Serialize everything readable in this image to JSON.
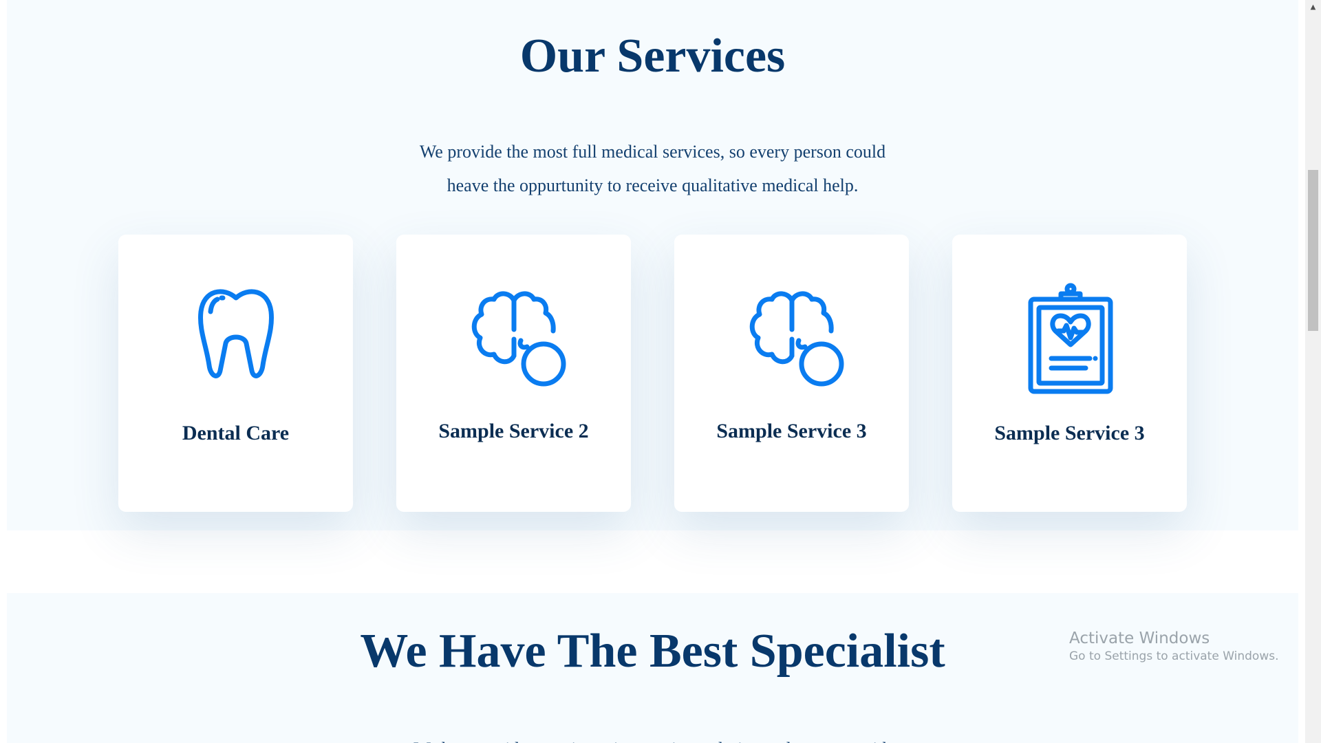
{
  "services": {
    "title": "Our Services",
    "description_lines": [
      "We provide the most full medical services, so every person could",
      "heave the oppurtunity to receive qualitative medical help."
    ],
    "cards": [
      {
        "title": "Dental Care",
        "icon": "tooth-icon"
      },
      {
        "title": "Sample Service 2",
        "icon": "brain-icon"
      },
      {
        "title": "Sample Service 3",
        "icon": "brain-icon"
      },
      {
        "title": "Sample Service 3",
        "icon": "clipboard-heart-icon"
      }
    ]
  },
  "specialist": {
    "title": "We Have The Best Specialist",
    "description": "We have a wide experience in experience design and strategy, with"
  },
  "watermark": {
    "title": "Activate Windows",
    "subtitle": "Go to Settings to activate Windows."
  },
  "colors": {
    "heading": "#08386b",
    "icon_blue": "#0a7cf0",
    "section_bg": "#f6fbfe",
    "card_bg": "#ffffff"
  }
}
